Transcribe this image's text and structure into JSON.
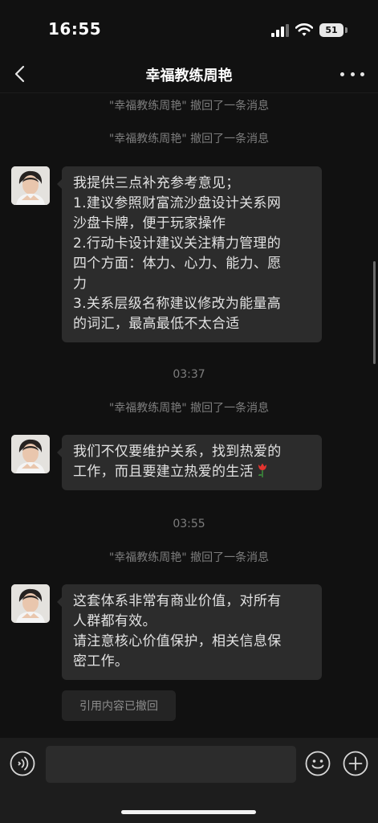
{
  "status_bar": {
    "time": "16:55",
    "battery_level": "51"
  },
  "nav": {
    "title": "幸福教练周艳"
  },
  "messages": {
    "recall_notice": "\"幸福教练周艳\" 撤回了一条消息",
    "timestamp_1": "03:37",
    "timestamp_2": "03:55",
    "msg1": [
      "我提供三点补充参考意见；",
      "1.建议参照财富流沙盘设计关系网",
      "沙盘卡牌，便于玩家操作",
      "2.行动卡设计建议关注精力管理的",
      "四个方面：体力、心力、能力、愿",
      "力",
      "3.关系层级名称建议修改为能量高",
      "的词汇，最高最低不太合适"
    ],
    "msg2": [
      "我们不仅要维护关系，找到热爱的",
      "工作，而且要建立热爱的生活"
    ],
    "msg3": [
      "这套体系非常有商业价值，对所有",
      "人群都有效。",
      "请注意核心价值保护，相关信息保",
      "密工作。"
    ],
    "quote_recalled": "引用内容已撤回"
  },
  "input": {
    "value": "",
    "placeholder": ""
  },
  "icons": {
    "back": "chevron-left-icon",
    "more": "more-dots-icon",
    "voice": "voice-icon",
    "emoji": "emoji-icon",
    "plus": "plus-icon",
    "tulip": "tulip-emoji"
  },
  "colors": {
    "background": "#111111",
    "bubble": "#2c2c2c",
    "system_text": "#7d7d7d",
    "input_bar": "#1d1d1d"
  }
}
